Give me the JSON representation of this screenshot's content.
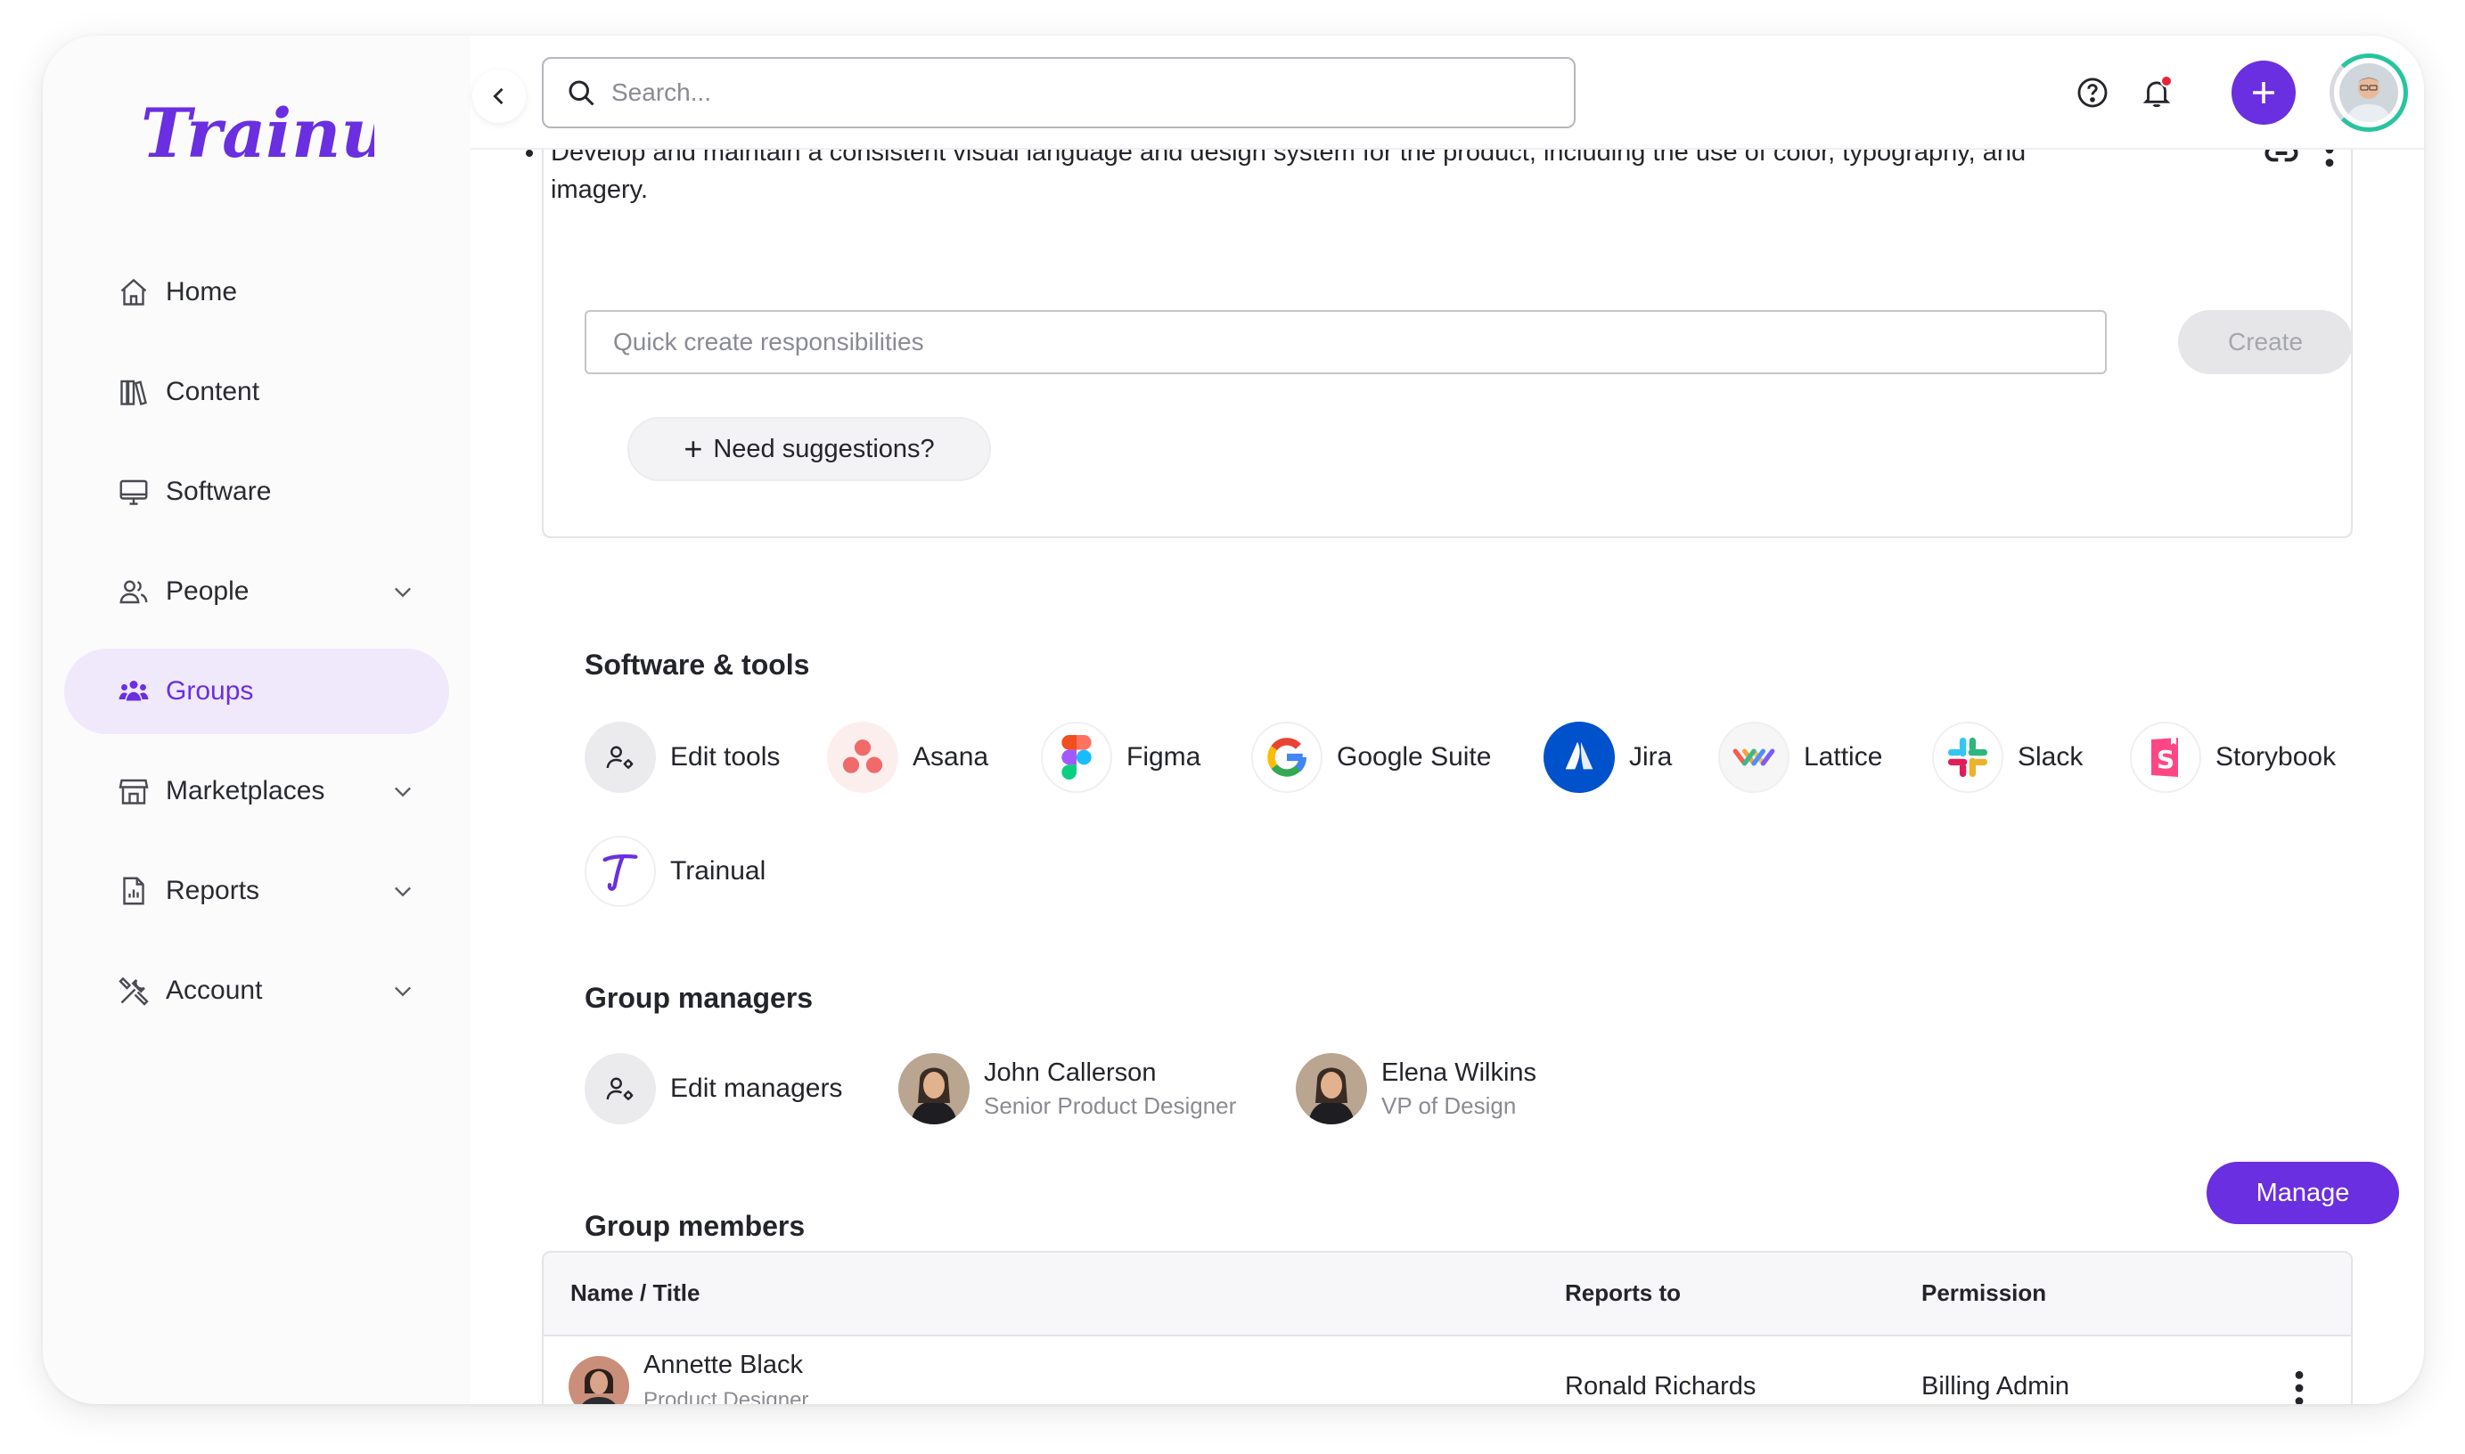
{
  "app": {
    "logo_text": "Trainual"
  },
  "sidebar": {
    "items": [
      {
        "label": "Home",
        "icon": "home-icon",
        "expandable": false,
        "active": false
      },
      {
        "label": "Content",
        "icon": "books-icon",
        "expandable": false,
        "active": false
      },
      {
        "label": "Software",
        "icon": "monitor-icon",
        "expandable": false,
        "active": false
      },
      {
        "label": "People",
        "icon": "people-icon",
        "expandable": true,
        "active": false
      },
      {
        "label": "Groups",
        "icon": "groups-icon",
        "expandable": false,
        "active": true
      },
      {
        "label": "Marketplaces",
        "icon": "store-icon",
        "expandable": true,
        "active": false
      },
      {
        "label": "Reports",
        "icon": "report-icon",
        "expandable": true,
        "active": false
      },
      {
        "label": "Account",
        "icon": "tools-icon",
        "expandable": true,
        "active": false
      }
    ]
  },
  "topbar": {
    "search_placeholder": "Search..."
  },
  "responsibilities": {
    "bullet": "Develop and maintain a consistent visual language and design system for the product, including the use of color, typography, and imagery.",
    "quick_create_placeholder": "Quick create responsibilities",
    "create_label": "Create",
    "suggestions_label": "Need suggestions?"
  },
  "software": {
    "title": "Software & tools",
    "edit_label": "Edit tools",
    "tools": [
      "Asana",
      "Figma",
      "Google Suite",
      "Jira",
      "Lattice",
      "Slack",
      "Storybook",
      "Trainual"
    ]
  },
  "managers": {
    "title": "Group managers",
    "edit_label": "Edit managers",
    "people": [
      {
        "name": "John Callerson",
        "title": "Senior Product Designer"
      },
      {
        "name": "Elena Wilkins",
        "title": "VP of Design"
      }
    ]
  },
  "members": {
    "title": "Group members",
    "manage_label": "Manage",
    "columns": {
      "name": "Name / Title",
      "reports_to": "Reports to",
      "permission": "Permission"
    },
    "rows": [
      {
        "name": "Annette Black",
        "title": "Product Designer",
        "reports_to": "Ronald Richards",
        "permission": "Billing Admin"
      }
    ]
  },
  "colors": {
    "accent": "#6a2fe0",
    "active_bg": "#efe9fb",
    "notification": "#e8243c",
    "progress_ring": "#27c4a0"
  }
}
